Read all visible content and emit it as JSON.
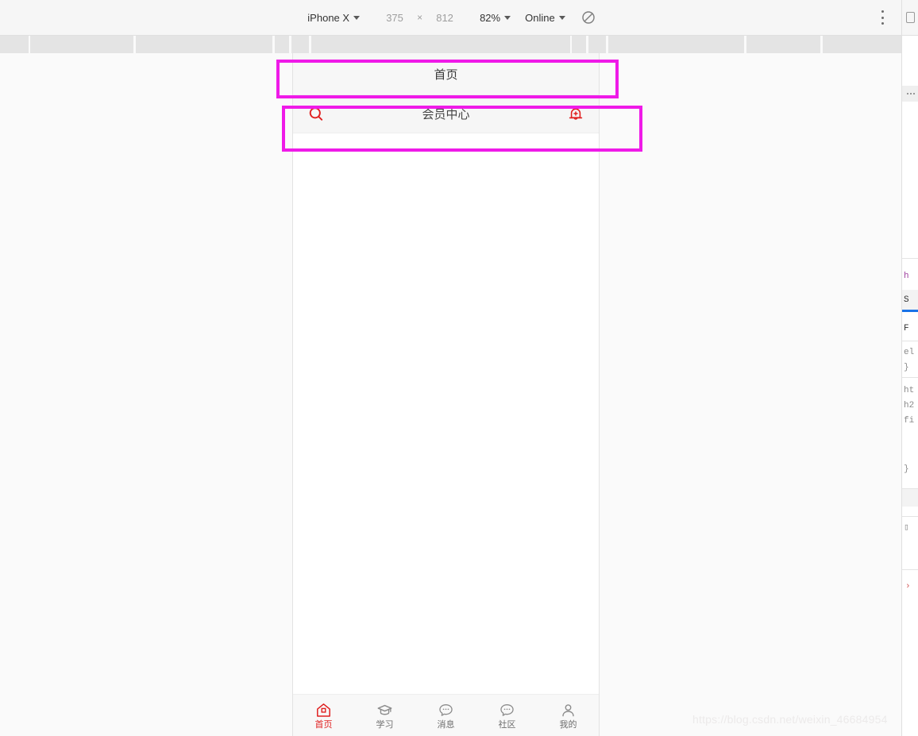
{
  "device_toolbar": {
    "device_name": "iPhone X",
    "width": "375",
    "height": "812",
    "multiply_symbol": "×",
    "zoom": "82%",
    "throttling": "Online",
    "rotate_icon": "rotate-device-icon",
    "menu_icon": "more-vertical-icon",
    "edge_icon": "device-frame-icon"
  },
  "phone": {
    "topbar": {
      "title": "首页"
    },
    "header": {
      "search_icon": "search-icon",
      "title": "会员中心",
      "notify_icon": "bell-add-icon"
    },
    "tabbar": [
      {
        "label": "首页",
        "icon": "home-icon",
        "active": true
      },
      {
        "label": "学习",
        "icon": "graduation-cap-icon",
        "active": false
      },
      {
        "label": "消息",
        "icon": "chat-bubble-icon",
        "active": false
      },
      {
        "label": "社区",
        "icon": "chat-bubble-icon",
        "active": false
      },
      {
        "label": "我的",
        "icon": "person-icon",
        "active": false
      }
    ]
  },
  "devtools_styles": {
    "overflow_icon": "more-horizontal-icon",
    "lines": [
      "h",
      "S",
      "F",
      "el",
      "}",
      "ht",
      "h2",
      "fi",
      "}"
    ],
    "scroll_arrow": "›"
  },
  "annotations": {
    "box_top": "highlight-box-page-title",
    "box_bottom": "highlight-box-header-bar",
    "color": "#ef1ae8"
  },
  "watermark": {
    "text": "https://blog.csdn.net/weixin_46684954"
  },
  "colors": {
    "accent_red": "#e02020",
    "annotation": "#ef1ae8",
    "toolbar_bg": "#f6f6f6",
    "canvas_bg": "#fafafa",
    "devtools_accent": "#1a73e8"
  }
}
